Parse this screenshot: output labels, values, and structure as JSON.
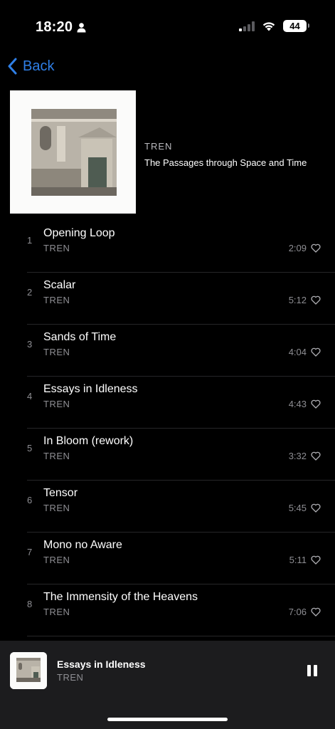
{
  "status_bar": {
    "time": "18:20",
    "battery": "44"
  },
  "nav": {
    "back_label": "Back"
  },
  "album": {
    "artist": "TREN",
    "title": "The Passages through Space and Time"
  },
  "tracks": [
    {
      "number": "1",
      "title": "Opening Loop",
      "artist": "TREN",
      "duration": "2:09"
    },
    {
      "number": "2",
      "title": "Scalar",
      "artist": "TREN",
      "duration": "5:12"
    },
    {
      "number": "3",
      "title": "Sands of Time",
      "artist": "TREN",
      "duration": "4:04"
    },
    {
      "number": "4",
      "title": "Essays in Idleness",
      "artist": "TREN",
      "duration": "4:43"
    },
    {
      "number": "5",
      "title": "In Bloom (rework)",
      "artist": "TREN",
      "duration": "3:32"
    },
    {
      "number": "6",
      "title": "Tensor",
      "artist": "TREN",
      "duration": "5:45"
    },
    {
      "number": "7",
      "title": "Mono no Aware",
      "artist": "TREN",
      "duration": "5:11"
    },
    {
      "number": "8",
      "title": "The Immensity of the Heavens",
      "artist": "TREN",
      "duration": "7:06"
    }
  ],
  "now_playing": {
    "title": "Essays in Idleness",
    "artist": "TREN"
  },
  "colors": {
    "accent": "#2f7fe6",
    "background": "#000000",
    "secondary_text": "#8e8e93",
    "mini_player_bg": "#1c1c1e"
  },
  "icons": [
    "person-icon",
    "signal-icon",
    "wifi-icon",
    "battery-icon",
    "chevron-left-icon",
    "heart-icon",
    "pause-icon"
  ]
}
